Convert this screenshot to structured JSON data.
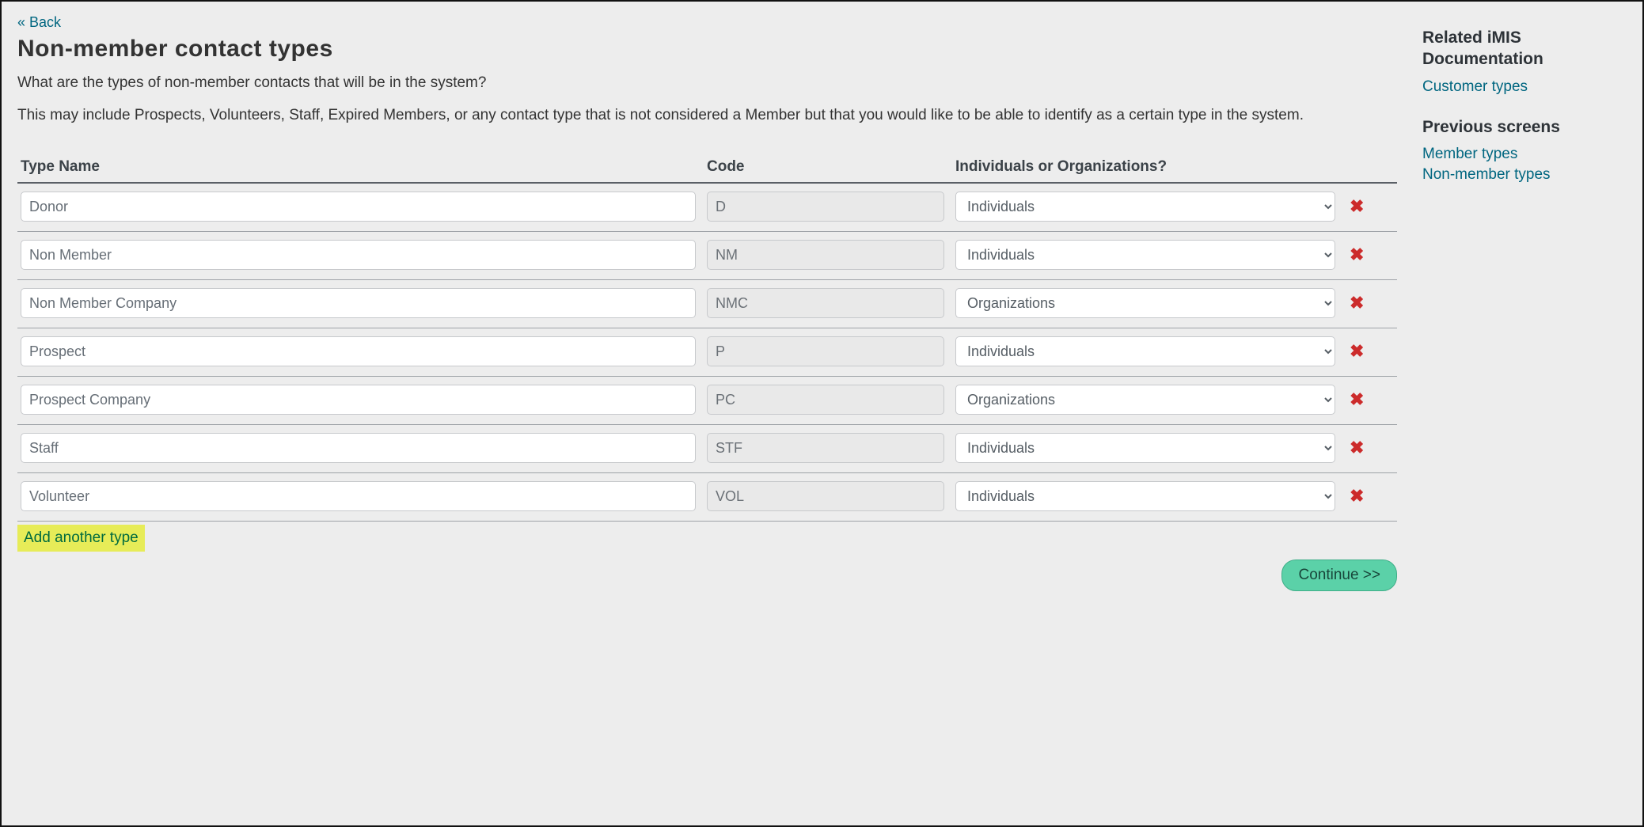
{
  "back_label": "« Back",
  "page_title": "Non-member contact types",
  "intro_1": "What are the types of non-member contacts that will be in the system?",
  "intro_2": "This may include Prospects, Volunteers, Staff, Expired Members, or any contact type that is not considered a Member but that you would like to be able to identify as a certain type in the system.",
  "columns": {
    "name": "Type Name",
    "code": "Code",
    "kind": "Individuals or Organizations?"
  },
  "select_options": [
    "Individuals",
    "Organizations"
  ],
  "rows": [
    {
      "name": "Donor",
      "code": "D",
      "kind": "Individuals"
    },
    {
      "name": "Non Member",
      "code": "NM",
      "kind": "Individuals"
    },
    {
      "name": "Non Member Company",
      "code": "NMC",
      "kind": "Organizations"
    },
    {
      "name": "Prospect",
      "code": "P",
      "kind": "Individuals"
    },
    {
      "name": "Prospect Company",
      "code": "PC",
      "kind": "Organizations"
    },
    {
      "name": "Staff",
      "code": "STF",
      "kind": "Individuals"
    },
    {
      "name": "Volunteer",
      "code": "VOL",
      "kind": "Individuals"
    }
  ],
  "add_label": "Add another type",
  "continue_label": "Continue >>",
  "sidebar": {
    "docs_heading": "Related iMIS Documentation",
    "docs_links": [
      {
        "label": "Customer types"
      }
    ],
    "prev_heading": "Previous screens",
    "prev_links": [
      {
        "label": "Member types"
      },
      {
        "label": "Non-member types"
      }
    ]
  },
  "icons": {
    "delete": "✖"
  }
}
